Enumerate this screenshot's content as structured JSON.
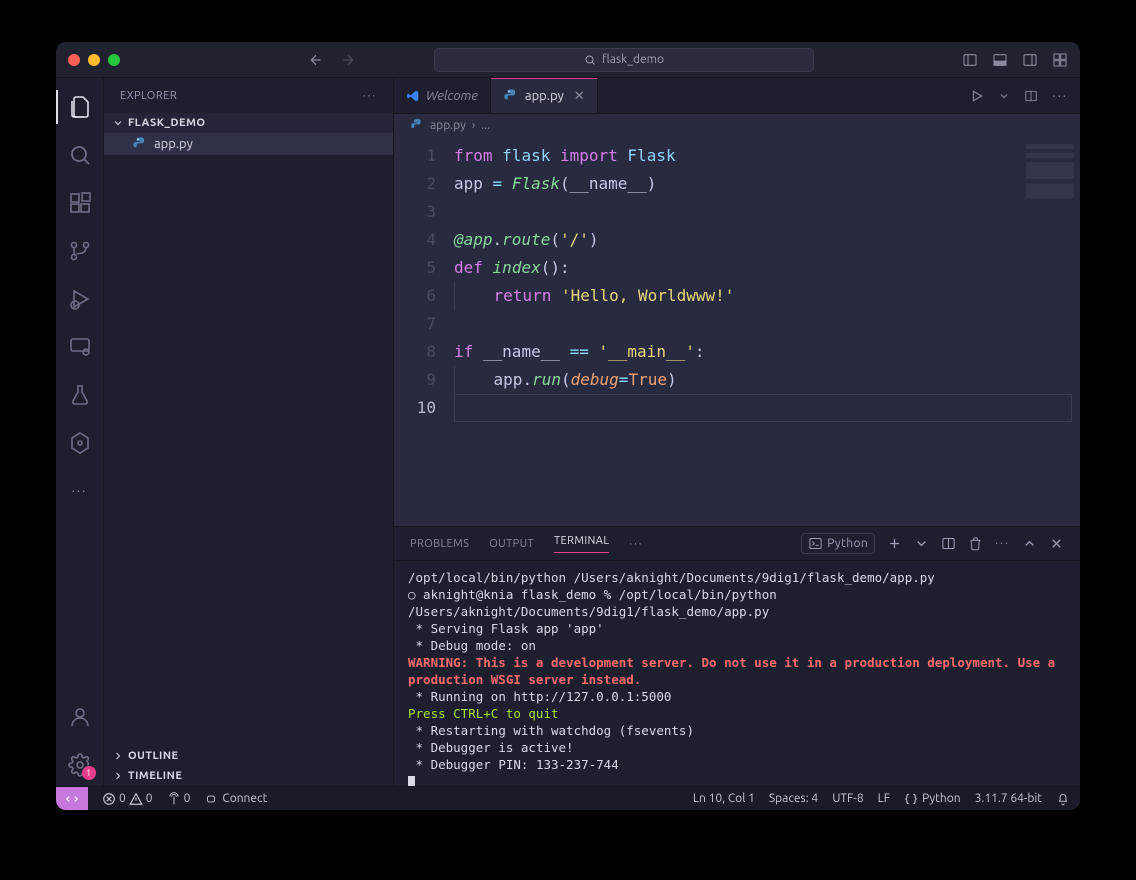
{
  "titlebar": {
    "search_label": "flask_demo"
  },
  "sidebar": {
    "title": "EXPLORER",
    "folder": "FLASK_DEMO",
    "files": [
      "app.py"
    ],
    "outline": "OUTLINE",
    "timeline": "TIMELINE"
  },
  "tabs": {
    "welcome": "Welcome",
    "active": "app.py"
  },
  "breadcrumb": {
    "file": "app.py",
    "sep": "›",
    "more": "..."
  },
  "code": {
    "lines": [
      {
        "n": 1,
        "html": "<span class='t-kw'>from</span> <span class='t-name'>flask</span> <span class='t-kw'>import</span> <span class='t-name'>Flask</span>"
      },
      {
        "n": 2,
        "html": "<span class='t-var'>app</span> <span class='t-op'>=</span> <span class='t-fn'>Flask</span>(<span class='t-var'>__name__</span>)"
      },
      {
        "n": 3,
        "html": ""
      },
      {
        "n": 4,
        "html": "<span class='t-dec'>@app</span>.<span class='t-fn'>route</span>(<span class='t-str'>'/'</span>)"
      },
      {
        "n": 5,
        "html": "<span class='t-kw'>def</span> <span class='t-fn'>index</span>():"
      },
      {
        "n": 6,
        "html": "<span class='ind-guide'>    </span><span class='t-kw'>return</span> <span class='t-str'>'Hello, Worldwww!'</span>"
      },
      {
        "n": 7,
        "html": ""
      },
      {
        "n": 8,
        "html": "<span class='t-kw'>if</span> <span class='t-var'>__name__</span> <span class='t-op'>==</span> <span class='t-str'>'__main__'</span>:"
      },
      {
        "n": 9,
        "html": "<span class='ind-guide'>    </span><span class='t-var'>app</span>.<span class='t-fn'>run</span>(<span class='t-param'>debug</span><span class='t-op'>=</span><span class='t-const'>True</span>)"
      },
      {
        "n": 10,
        "html": ""
      }
    ],
    "current_line": 10
  },
  "panel": {
    "tabs": {
      "problems": "PROBLEMS",
      "output": "OUTPUT",
      "terminal": "TERMINAL"
    },
    "shell_label": "Python",
    "lines": [
      {
        "cls": "",
        "text": "/opt/local/bin/python /Users/aknight/Documents/9dig1/flask_demo/app.py"
      },
      {
        "cls": "",
        "text": "aknight@knia flask_demo % /opt/local/bin/python /Users/aknight/Documents/9dig1/flask_demo/app.py",
        "lead": "○ "
      },
      {
        "cls": "",
        "text": " * Serving Flask app 'app'"
      },
      {
        "cls": "",
        "text": " * Debug mode: on"
      },
      {
        "cls": "term-warn",
        "text": "WARNING: This is a development server. Do not use it in a production deployment. Use a production WSGI server instead."
      },
      {
        "cls": "",
        "text": " * Running on http://127.0.0.1:5000"
      },
      {
        "cls": "term-green",
        "text": "Press CTRL+C to quit"
      },
      {
        "cls": "",
        "text": " * Restarting with watchdog (fsevents)"
      },
      {
        "cls": "",
        "text": " * Debugger is active!"
      },
      {
        "cls": "",
        "text": " * Debugger PIN: 133-237-744"
      }
    ]
  },
  "status": {
    "errors": "0",
    "warnings": "0",
    "ports": "0",
    "connect": "Connect",
    "ln_col": "Ln 10, Col 1",
    "spaces": "Spaces: 4",
    "encoding": "UTF-8",
    "eol": "LF",
    "lang": "Python",
    "runtime": "3.11.7 64-bit"
  },
  "settings_badge": "1"
}
